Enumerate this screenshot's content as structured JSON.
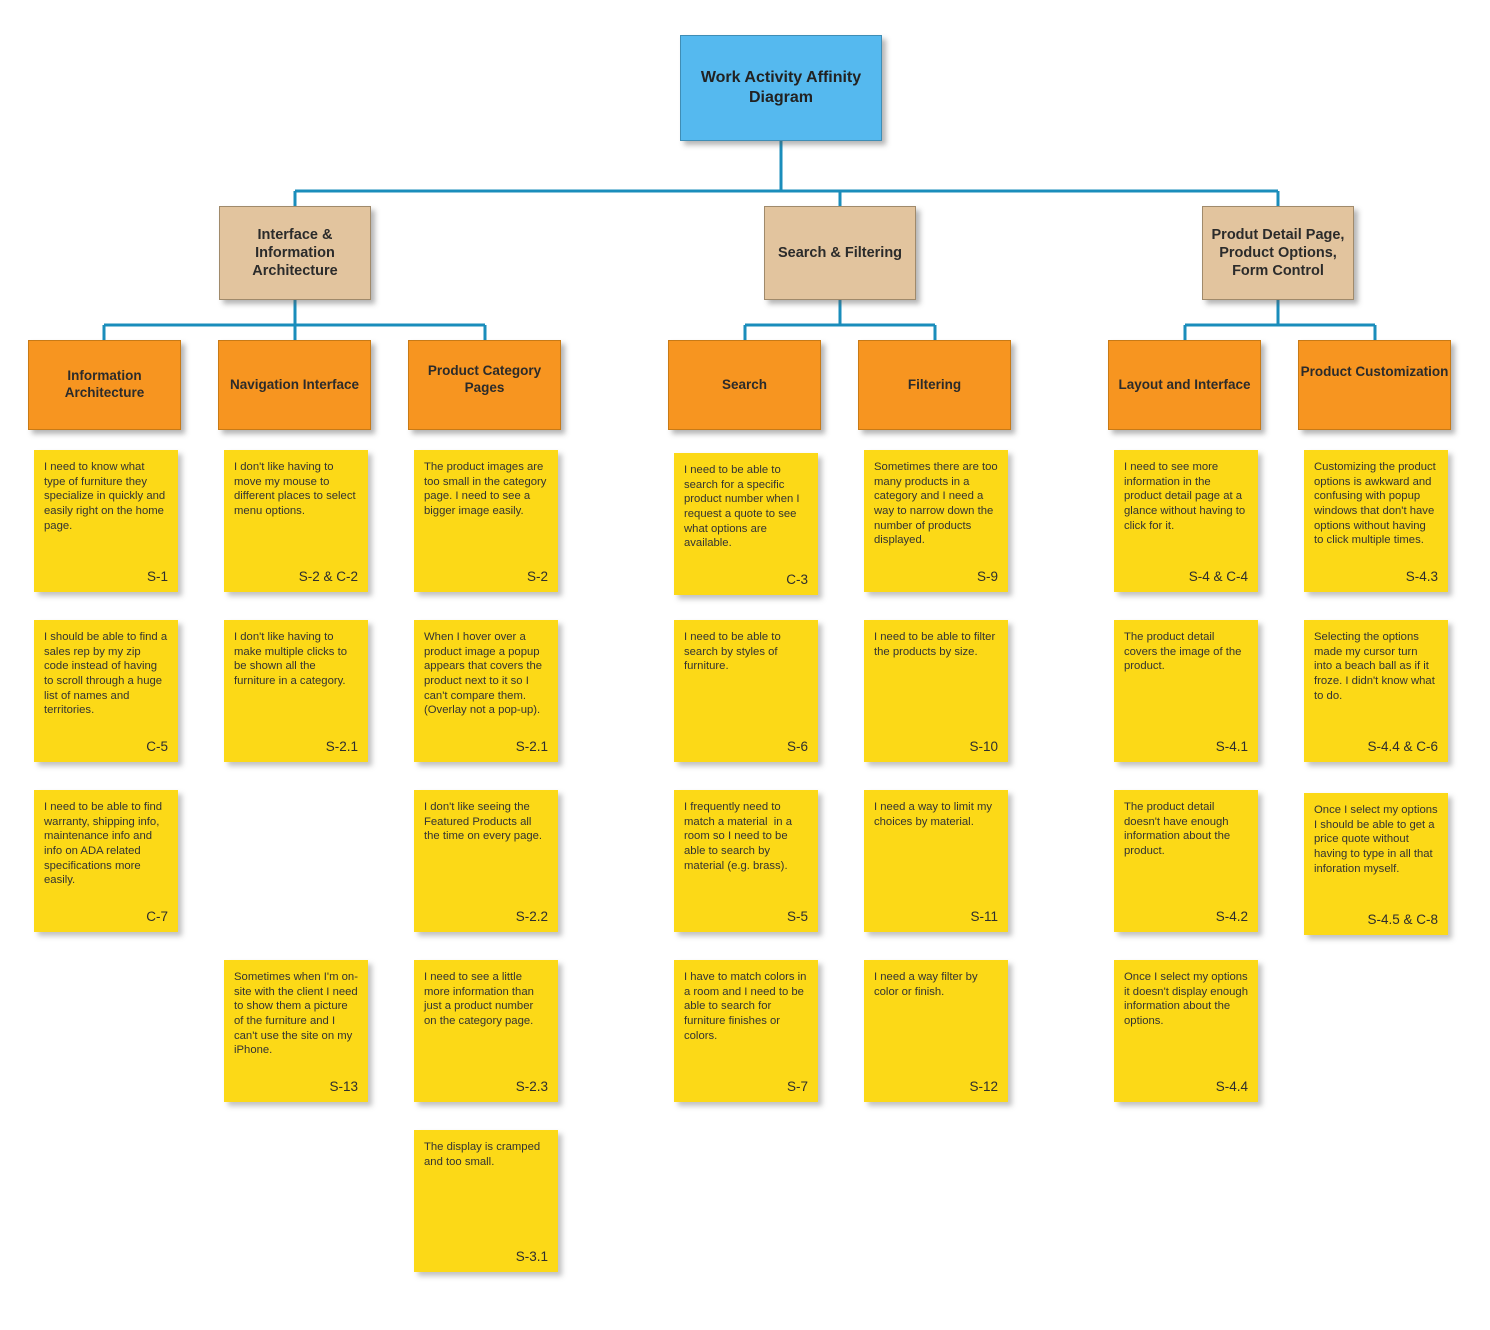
{
  "diagram": {
    "title": "Work Activity Affinity Diagram",
    "colors": {
      "root": "#55b9ef",
      "theme": "#e2c49e",
      "category": "#f79520",
      "note": "#fcd917",
      "connector": "#1a8dbb"
    }
  },
  "themes": [
    {
      "label": "Interface & Information Architecture"
    },
    {
      "label": "Search & Filtering"
    },
    {
      "label": "Produt Detail Page, Product Options, Form Control"
    }
  ],
  "categories": [
    {
      "label": "Information Architecture"
    },
    {
      "label": "Navigation Interface"
    },
    {
      "label": "Product Category Pages"
    },
    {
      "label": "Search"
    },
    {
      "label": "Filtering"
    },
    {
      "label": "Layout and Interface"
    },
    {
      "label": "Product Customization"
    }
  ],
  "notes": {
    "information_architecture": [
      {
        "text": "I need to know what type of furniture they specialize in quickly and easily right on the home page.",
        "code": "S-1"
      },
      {
        "text": "I should be able to find a sales rep by my zip code instead of having to scroll through a huge list of names and territories.",
        "code": "C-5"
      },
      {
        "text": "I need to be able to find warranty, shipping info, maintenance info and info on ADA related specifications more easily.",
        "code": "C-7"
      }
    ],
    "navigation_interface": [
      {
        "text": "I don't like having to move my mouse to different places to select menu options.",
        "code": "S-2 & C-2"
      },
      {
        "text": "I don't like having to make multiple clicks to be shown all the furniture in a category.",
        "code": "S-2.1"
      },
      {
        "text": "Sometimes when I'm on-site with the client I need to show them a picture of the furniture and I can't use the site on my iPhone.",
        "code": "S-13"
      }
    ],
    "product_category_pages": [
      {
        "text": "The product images are too small in the category page. I need to see a bigger image easily.",
        "code": "S-2"
      },
      {
        "text": "When I hover over a product image a popup appears that covers the product next to it so I can't compare them. (Overlay not a pop-up).",
        "code": "S-2.1"
      },
      {
        "text": "I don't like seeing the Featured Products all the time on every page.",
        "code": "S-2.2"
      },
      {
        "text": "I need to see a little more information than just a product number on the category page.",
        "code": "S-2.3"
      },
      {
        "text": "The display is cramped and too small.",
        "code": "S-3.1"
      }
    ],
    "search": [
      {
        "text": "I need to be able to search for a specific product number when I request a quote to see what options are available.",
        "code": "C-3"
      },
      {
        "text": "I need to be able to search by styles of furniture.",
        "code": "S-6"
      },
      {
        "text": "I frequently need to match a material  in a room so I need to be able to search by material (e.g. brass).",
        "code": "S-5"
      },
      {
        "text": "I have to match colors in a room and I need to be able to search for furniture finishes or colors.",
        "code": "S-7"
      }
    ],
    "filtering": [
      {
        "text": "Sometimes there are too many products in a category and I need a way to narrow down the number of products displayed.",
        "code": "S-9"
      },
      {
        "text": "I need to be able to filter the products by size.",
        "code": "S-10"
      },
      {
        "text": "I need a way to limit my choices by material.",
        "code": "S-11"
      },
      {
        "text": "I need a way filter by color or finish.",
        "code": "S-12"
      }
    ],
    "layout_and_interface": [
      {
        "text": "I need to see more information in the product detail page at a glance without having to click for it.",
        "code": "S-4 & C-4"
      },
      {
        "text": "The product detail covers the image of the product.",
        "code": "S-4.1"
      },
      {
        "text": "The product detail doesn't have enough information about the product.",
        "code": "S-4.2"
      },
      {
        "text": "Once I select my options it doesn't display enough information about the options.",
        "code": "S-4.4"
      }
    ],
    "product_customization": [
      {
        "text": "Customizing the product options is awkward and confusing with popup windows that don't have options without having to click multiple times.",
        "code": "S-4.3"
      },
      {
        "text": "Selecting the options made my cursor turn into a beach ball as if it froze. I didn't know what to do.",
        "code": "S-4.4 & C-6"
      },
      {
        "text": "Once I select my options I should be able to get a price quote without having to type in all that inforation myself.",
        "code": "S-4.5 & C-8"
      }
    ]
  }
}
